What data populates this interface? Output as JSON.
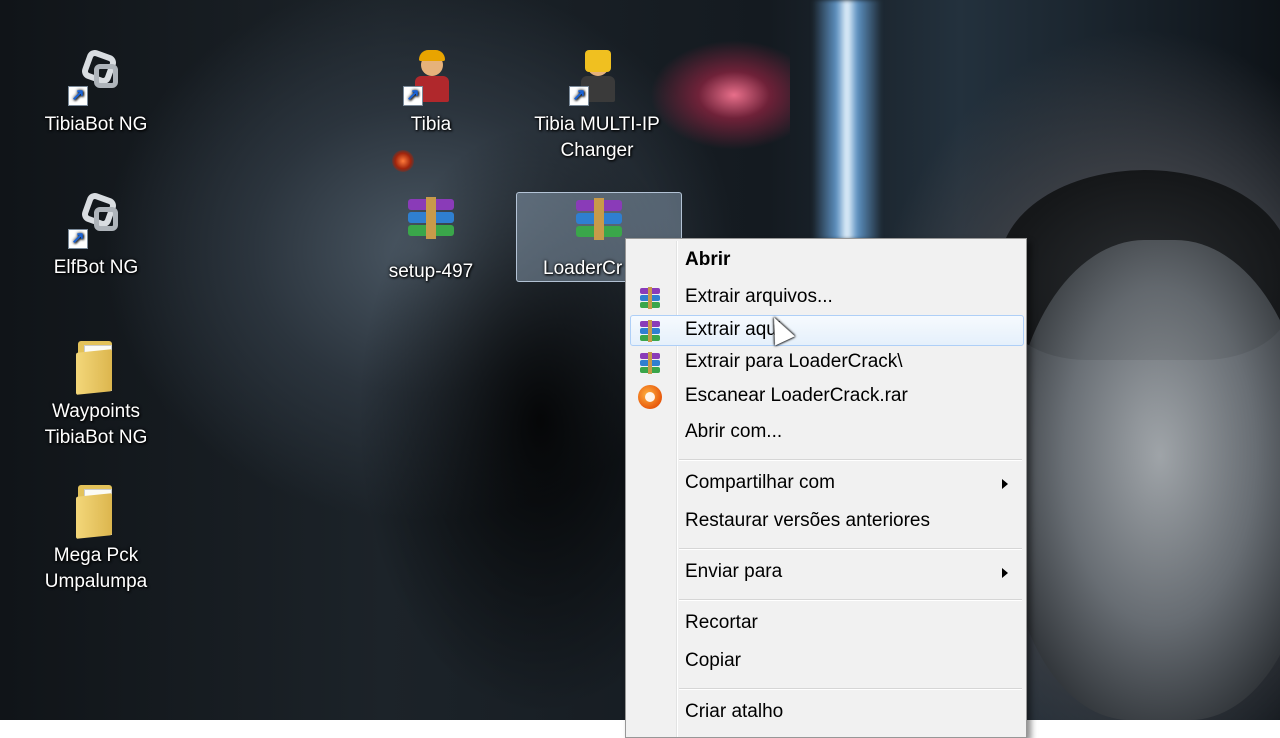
{
  "desktop": {
    "icons": [
      {
        "label": "TibiaBot NG",
        "icon": "gear-shortcut-icon"
      },
      {
        "label": "ElfBot NG",
        "icon": "gear-shortcut-icon"
      },
      {
        "label": "Waypoints TibiaBot NG",
        "icon": "folder-icon"
      },
      {
        "label": "Mega Pck Umpalumpa",
        "icon": "folder-icon"
      },
      {
        "label": "Tibia",
        "icon": "tibia-character-icon"
      },
      {
        "label": "Tibia MULTI-IP Changer",
        "icon": "miner-character-icon"
      },
      {
        "label": "setup-497",
        "icon": "winrar-archive-icon"
      },
      {
        "label": "LoaderCr",
        "icon": "winrar-archive-icon",
        "selected": true
      }
    ]
  },
  "context_menu": {
    "items": [
      {
        "label": "Abrir",
        "bold": true
      },
      {
        "label": "Extrair arquivos...",
        "icon": "winrar-icon"
      },
      {
        "label": "Extrair aqui",
        "icon": "winrar-icon",
        "hovered": true
      },
      {
        "label": "Extrair para LoaderCrack\\",
        "icon": "winrar-icon"
      },
      {
        "label": "Escanear LoaderCrack.rar",
        "icon": "avast-icon"
      },
      {
        "label": "Abrir com..."
      },
      {
        "label": "Compartilhar com",
        "submenu": true
      },
      {
        "label": "Restaurar versões anteriores"
      },
      {
        "label": "Enviar para",
        "submenu": true
      },
      {
        "label": "Recortar"
      },
      {
        "label": "Copiar"
      },
      {
        "label": "Criar atalho"
      }
    ]
  },
  "colors": {
    "menu_background": "#f1f1f1",
    "menu_hover": "#e5f0fb",
    "menu_hover_border": "#aecff7",
    "icon_text": "#ffffff"
  }
}
